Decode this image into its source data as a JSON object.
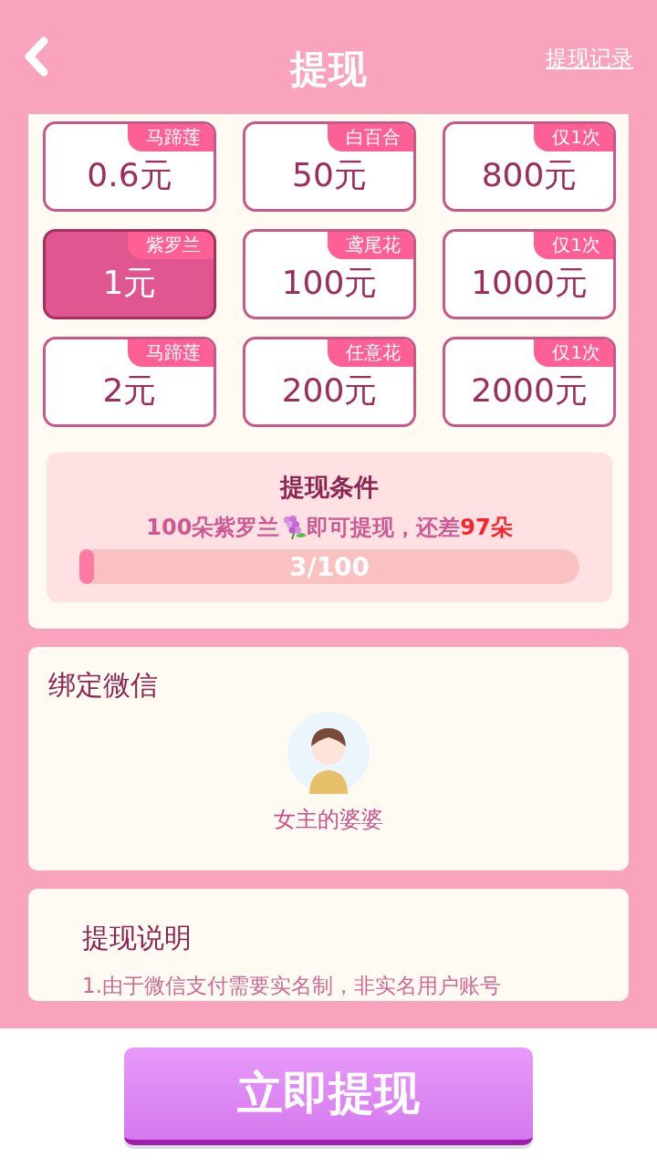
{
  "header": {
    "title": "提现",
    "records_link": "提现记录"
  },
  "options": [
    {
      "tag": "马蹄莲",
      "amount": "0.6元",
      "selected": false
    },
    {
      "tag": "白百合",
      "amount": "50元",
      "selected": false
    },
    {
      "tag": "仅1次",
      "amount": "800元",
      "selected": false
    },
    {
      "tag": "紫罗兰",
      "amount": "1元",
      "selected": true
    },
    {
      "tag": "鸢尾花",
      "amount": "100元",
      "selected": false
    },
    {
      "tag": "仅1次",
      "amount": "1000元",
      "selected": false
    },
    {
      "tag": "马蹄莲",
      "amount": "2元",
      "selected": false
    },
    {
      "tag": "任意花",
      "amount": "200元",
      "selected": false
    },
    {
      "tag": "仅1次",
      "amount": "2000元",
      "selected": false
    }
  ],
  "condition": {
    "title": "提现条件",
    "prefix": "100朵紫罗兰",
    "suffix": "即可提现，还差",
    "remaining": "97朵",
    "level": 0.03,
    "progress_text": "3/100"
  },
  "wechat": {
    "title": "绑定微信",
    "name": "女主的婆婆"
  },
  "notes": {
    "title": "提现说明",
    "lines": [
      "1.由于微信支付需要实名制，非实名用户账号"
    ]
  },
  "submit_button": "立即提现"
}
